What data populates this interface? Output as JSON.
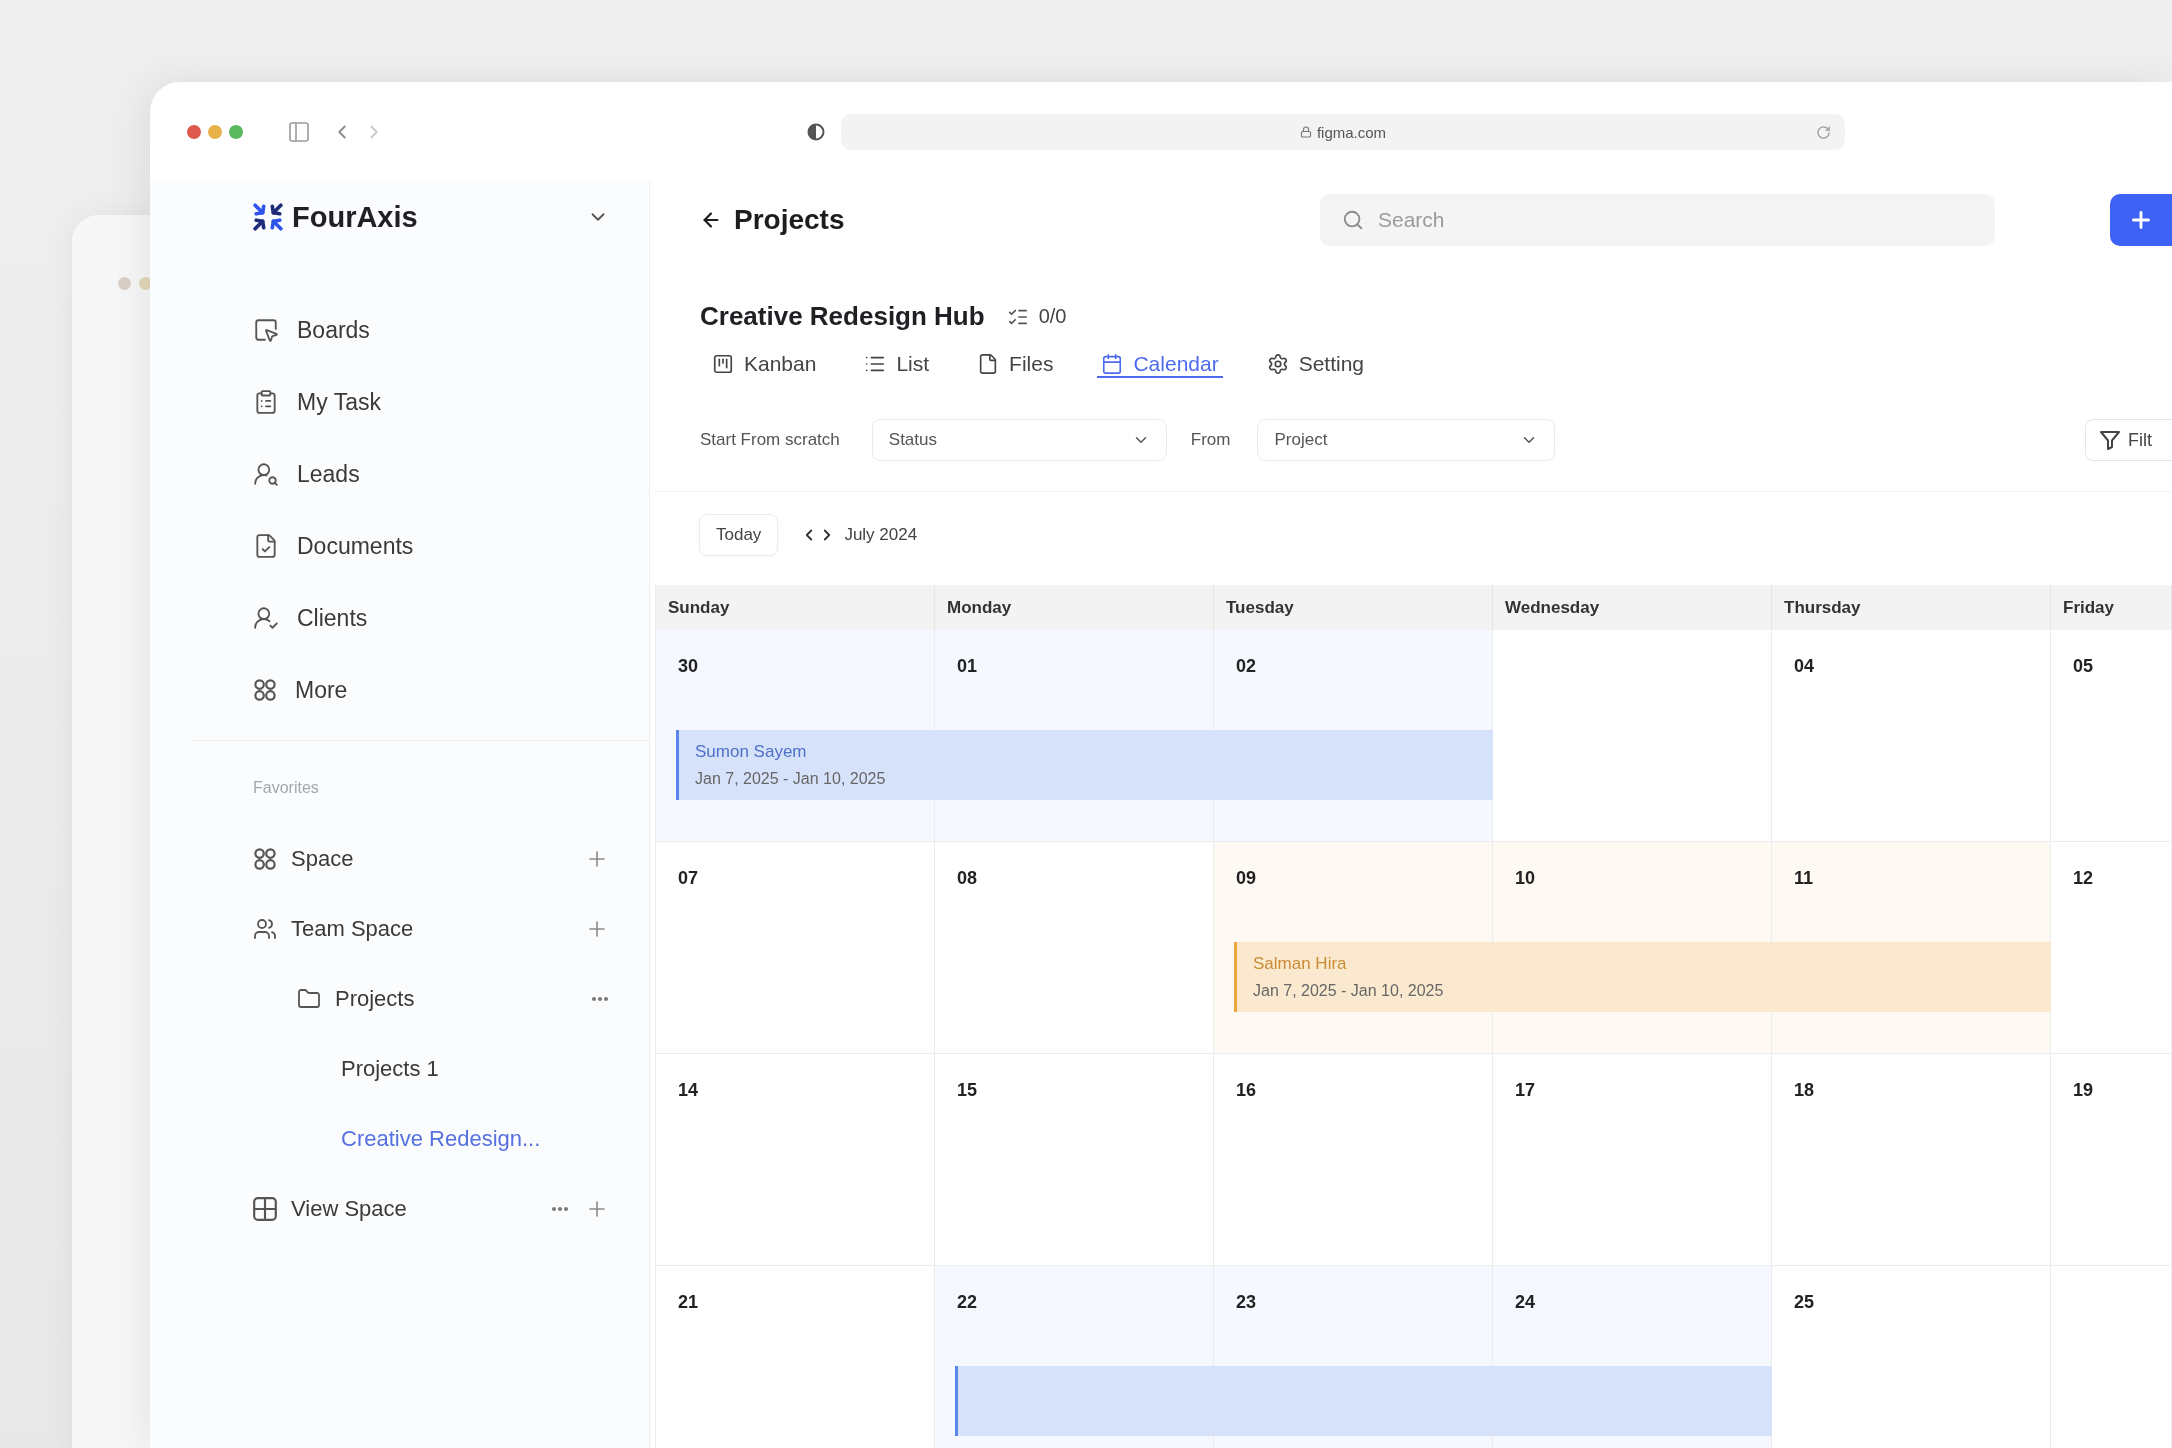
{
  "browser": {
    "url": "figma.com"
  },
  "sidebar": {
    "brand": "FourAxis",
    "nav": [
      {
        "label": "Boards"
      },
      {
        "label": "My Task"
      },
      {
        "label": "Leads"
      },
      {
        "label": "Documents"
      },
      {
        "label": "Clients"
      },
      {
        "label": "More"
      }
    ],
    "favorites": {
      "title": "Favorites",
      "items": [
        {
          "label": "Space",
          "selected": false,
          "actions": [
            {
              "kind": "add"
            }
          ]
        },
        {
          "label": "Team Space",
          "selected": false,
          "actions": [
            {
              "kind": "add"
            }
          ],
          "children": [
            {
              "label": "Projects",
              "selected": false,
              "actions": [
                {
                  "kind": "more"
                }
              ],
              "children": [
                {
                  "label": "Projects 1",
                  "selected": false
                },
                {
                  "label": "Creative Redesign...",
                  "selected": true
                }
              ]
            }
          ]
        },
        {
          "label": "View Space",
          "selected": false,
          "actions": [
            {
              "kind": "more"
            },
            {
              "kind": "add"
            }
          ]
        }
      ]
    }
  },
  "header": {
    "back_label": "Projects",
    "search": {
      "placeholder": "Search"
    }
  },
  "project": {
    "title": "Creative Redesign Hub",
    "progress": "0/0"
  },
  "tabs": [
    {
      "label": "Kanban",
      "selected": false
    },
    {
      "label": "List",
      "selected": false
    },
    {
      "label": "Files",
      "selected": false
    },
    {
      "label": "Calendar",
      "selected": true
    },
    {
      "label": "Setting",
      "selected": false
    }
  ],
  "filters": {
    "label": "Start From scratch",
    "status": {
      "value": "Status"
    },
    "from_label": "From",
    "project": {
      "value": "Project"
    },
    "filter_button": {
      "label": "Filt"
    }
  },
  "calendar": {
    "today": "Today",
    "month": "July 2024",
    "weekdays": [
      "Sunday",
      "Monday",
      "Tuesday",
      "Wednesday",
      "Thursday",
      "Friday"
    ],
    "weeks": [
      {
        "segments": [
          {
            "event": {
              "name": "Sumon Sayem",
              "dates": "Jan 7, 2025 - Jan 10, 2025",
              "color": "#5b86ea"
            },
            "days": [
              {
                "kind": "date",
                "label": "30"
              },
              {
                "kind": "date",
                "label": "01"
              },
              {
                "kind": "date",
                "label": "02"
              }
            ]
          },
          {
            "days": [
              {
                "kind": "blank"
              },
              {
                "kind": "date",
                "label": "04"
              },
              {
                "kind": "date",
                "label": "05"
              }
            ]
          }
        ]
      },
      {
        "segments": [
          {
            "days": [
              {
                "kind": "date",
                "label": "07"
              },
              {
                "kind": "date",
                "label": "08"
              }
            ]
          },
          {
            "event": {
              "name": "Salman Hira",
              "dates": "Jan 7, 2025 - Jan 10, 2025",
              "color": "#eda53e"
            },
            "days": [
              {
                "kind": "date",
                "label": "09"
              },
              {
                "kind": "date",
                "label": "10"
              },
              {
                "kind": "date",
                "label": "11"
              }
            ]
          },
          {
            "days": [
              {
                "kind": "date",
                "label": "12"
              }
            ]
          }
        ]
      },
      {
        "segments": [
          {
            "days": [
              {
                "kind": "date",
                "label": "14"
              },
              {
                "kind": "date",
                "label": "15"
              },
              {
                "kind": "date",
                "label": "16"
              },
              {
                "kind": "date",
                "label": "17"
              },
              {
                "kind": "date",
                "label": "18"
              },
              {
                "kind": "date",
                "label": "19"
              }
            ]
          }
        ]
      },
      {
        "segments": [
          {
            "days": [
              {
                "kind": "date",
                "label": "21"
              }
            ]
          },
          {
            "event": {
              "color": "#5b86ea"
            },
            "days": [
              {
                "kind": "date",
                "label": "22"
              },
              {
                "kind": "date",
                "label": "23"
              },
              {
                "kind": "date",
                "label": "24"
              }
            ]
          },
          {
            "days": [
              {
                "kind": "date",
                "label": "25"
              },
              {
                "kind": "blank"
              }
            ]
          }
        ]
      }
    ]
  }
}
